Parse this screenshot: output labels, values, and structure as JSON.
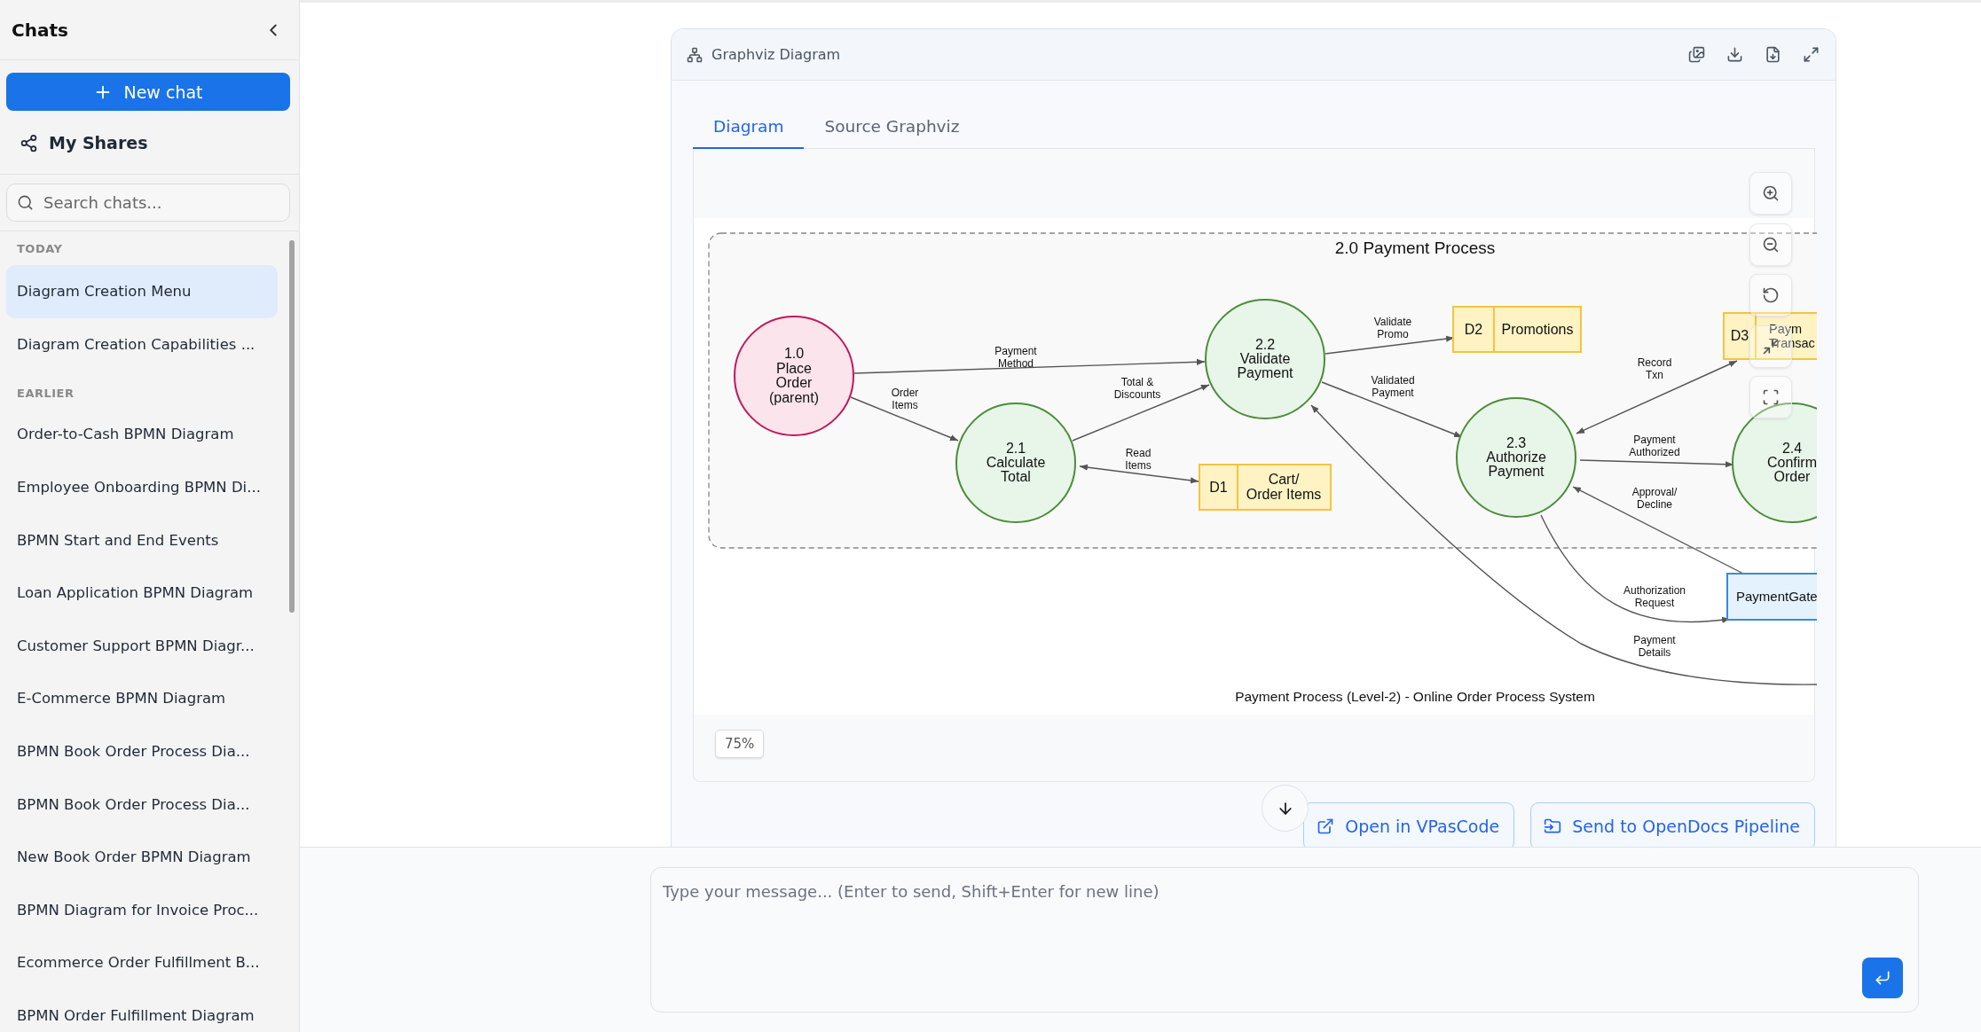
{
  "sidebar": {
    "title": "Chats",
    "new_chat": "New chat",
    "my_shares": "My Shares",
    "search": {
      "placeholder": "Search chats..."
    },
    "groups": [
      {
        "label": "TODAY",
        "items": [
          {
            "title": "Diagram Creation Menu",
            "selected": true
          },
          {
            "title": "Diagram Creation Capabilities ...",
            "selected": false
          }
        ]
      },
      {
        "label": "EARLIER",
        "items": [
          {
            "title": "Order-to-Cash BPMN Diagram",
            "selected": false
          },
          {
            "title": "Employee Onboarding BPMN Di...",
            "selected": false
          },
          {
            "title": "BPMN Start and End Events",
            "selected": false
          },
          {
            "title": "Loan Application BPMN Diagram",
            "selected": false
          },
          {
            "title": "Customer Support BPMN Diagr...",
            "selected": false
          },
          {
            "title": "E-Commerce BPMN Diagram",
            "selected": false
          },
          {
            "title": "BPMN Book Order Process Dia...",
            "selected": false
          },
          {
            "title": "BPMN Book Order Process Dia...",
            "selected": false
          },
          {
            "title": "New Book Order BPMN Diagram",
            "selected": false
          },
          {
            "title": "BPMN Diagram for Invoice Proc...",
            "selected": false
          },
          {
            "title": "Ecommerce Order Fulfillment B...",
            "selected": false
          },
          {
            "title": "BPMN Order Fulfillment Diagram",
            "selected": false
          }
        ]
      }
    ]
  },
  "card": {
    "title": "Graphviz Diagram",
    "tabs": [
      {
        "label": "Diagram",
        "selected": true
      },
      {
        "label": "Source Graphviz",
        "selected": false
      }
    ],
    "diagram": {
      "cluster_title": "2.0 Payment Process",
      "caption": "Payment Process (Level-2) - Online Order Process System",
      "nodes": [
        {
          "kind": "parent",
          "lines": [
            "1.0",
            "Place",
            "Order",
            "(parent)"
          ]
        },
        {
          "kind": "process",
          "lines": [
            "2.1",
            "Calculate",
            "Total"
          ]
        },
        {
          "kind": "process",
          "lines": [
            "2.2",
            "Validate",
            "Payment"
          ]
        },
        {
          "kind": "process",
          "lines": [
            "2.3",
            "Authorize",
            "Payment"
          ]
        },
        {
          "kind": "process",
          "lines": [
            "2.4",
            "Confirm",
            "Order"
          ]
        },
        {
          "kind": "store",
          "id": "D1",
          "lines": [
            "Cart/",
            "Order Items"
          ]
        },
        {
          "kind": "store",
          "id": "D2",
          "lines": [
            "Promotions"
          ]
        },
        {
          "kind": "store",
          "id": "D3",
          "lines": [
            "Paym",
            "Transac"
          ]
        },
        {
          "kind": "entity",
          "lines": [
            "PaymentGate"
          ]
        }
      ],
      "edges": [
        {
          "label": [
            "Payment",
            "Method"
          ],
          "bidirectional": false
        },
        {
          "label": [
            "Order",
            "Items"
          ],
          "bidirectional": false
        },
        {
          "label": [
            "Total &",
            "Discounts"
          ],
          "bidirectional": false
        },
        {
          "label": [
            "Read",
            "Items"
          ],
          "bidirectional": true
        },
        {
          "label": [
            "Validate",
            "Promo"
          ],
          "bidirectional": false
        },
        {
          "label": [
            "Validated",
            "Payment"
          ],
          "bidirectional": false
        },
        {
          "label": [
            "Record",
            "Txn"
          ],
          "bidirectional": true
        },
        {
          "label": [
            "Payment",
            "Authorized"
          ],
          "bidirectional": false
        },
        {
          "label": [
            "Approval/",
            "Decline"
          ],
          "bidirectional": false
        },
        {
          "label": [
            "Authorization",
            "Request"
          ],
          "bidirectional": false
        },
        {
          "label": [
            "Payment",
            "Details"
          ],
          "bidirectional": false
        }
      ]
    },
    "zoom": "75%",
    "actions": [
      "Open in VPasCode",
      "Send to OpenDocs Pipeline"
    ]
  },
  "composer": {
    "placeholder": "Type your message... (Enter to send, Shift+Enter for new line)"
  }
}
